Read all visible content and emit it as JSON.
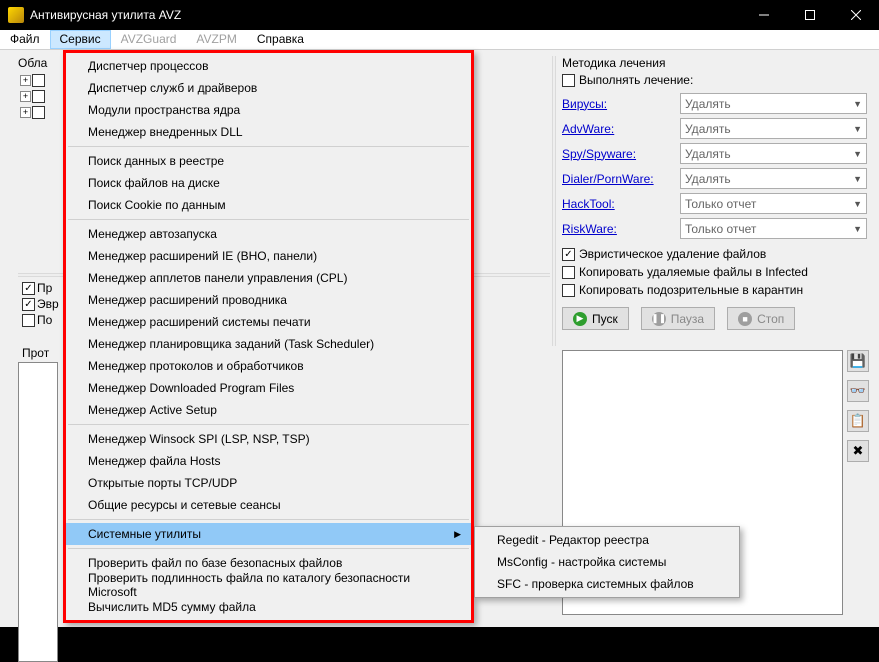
{
  "title": "Антивирусная утилита AVZ",
  "menubar": [
    "Файл",
    "Сервис",
    "AVZGuard",
    "AVZPM",
    "Справка"
  ],
  "left": {
    "obl_label": "Обла",
    "chk1": "Пр",
    "chk2": "Эвр",
    "chk3": "По",
    "proto": "Прот"
  },
  "dropdown": {
    "g1": [
      "Диспетчер процессов",
      "Диспетчер служб и драйверов",
      "Модули пространства ядра",
      "Менеджер внедренных DLL"
    ],
    "g2": [
      "Поиск данных  в реестре",
      "Поиск файлов на диске",
      "Поиск Cookie по данным"
    ],
    "g3": [
      "Менеджер автозапуска",
      "Менеджер расширений IE (BHO, панели)",
      "Менеджер апплетов панели управления (CPL)",
      "Менеджер расширений проводника",
      "Менеджер расширений системы печати",
      "Менеджер планировщика заданий (Task Scheduler)",
      "Менеджер протоколов и обработчиков",
      "Менеджер Downloaded Program Files",
      "Менеджер Active Setup"
    ],
    "g4": [
      "Менеджер Winsock SPI (LSP, NSP, TSP)",
      "Менеджер файла Hosts",
      "Открытые порты TCP/UDP",
      "Общие ресурсы и сетевые сеансы"
    ],
    "sys": "Системные утилиты",
    "g5": [
      "Проверить файл по базе безопасных файлов",
      "Проверить подлинность файла по каталогу безопасности Microsoft",
      "Вычислить MD5 сумму файла"
    ]
  },
  "submenu": [
    "Regedit - Редактор реестра",
    "MsConfig - настройка системы",
    "SFC - проверка системных файлов"
  ],
  "right": {
    "group_title": "Методика лечения",
    "heal_chk": "Выполнять лечение:",
    "cats": [
      {
        "name": "Вирусы:",
        "val": "Удалять"
      },
      {
        "name": "AdvWare:",
        "val": "Удалять"
      },
      {
        "name": "Spy/Spyware:",
        "val": "Удалять"
      },
      {
        "name": "Dialer/PornWare:",
        "val": "Удалять"
      },
      {
        "name": "HackTool:",
        "val": "Только отчет"
      },
      {
        "name": "RiskWare:",
        "val": "Только отчет"
      }
    ],
    "heur": "Эвристическое удаление файлов",
    "copy_inf": "Копировать удаляемые файлы в  Infected",
    "copy_quar": "Копировать подозрительные в  карантин",
    "btn_start": "Пуск",
    "btn_pause": "Пауза",
    "btn_stop": "Стоп"
  }
}
